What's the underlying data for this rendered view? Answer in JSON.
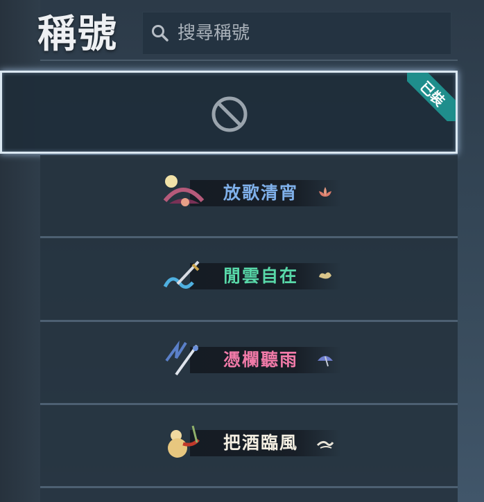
{
  "header": {
    "title": "稱號"
  },
  "search": {
    "placeholder": "搜尋稱號"
  },
  "equipped_label": "已裝",
  "titles": [
    {
      "name": "放歌清宵",
      "color": "#7fb0ea"
    },
    {
      "name": "閒雲自在",
      "color": "#58d8a8"
    },
    {
      "name": "憑欄聽雨",
      "color": "#f07aa8"
    },
    {
      "name": "把酒臨風",
      "color": "#f4efe2"
    }
  ],
  "colors": {
    "selection_glow": "#dbe8f2",
    "equipped_ribbon": "#1f8e8c"
  },
  "icons": {
    "search": "search-icon",
    "none": "no-title-icon"
  }
}
